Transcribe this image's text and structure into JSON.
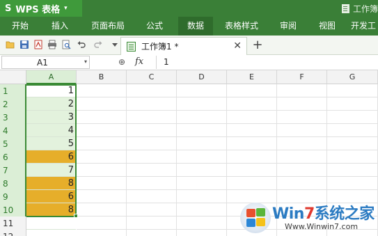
{
  "app": {
    "logo_glyph": "S",
    "name": "WPS 表格",
    "caret": "▾",
    "window_title": "工作簿"
  },
  "ribbon_tabs": [
    {
      "label": "开始"
    },
    {
      "label": "插入"
    },
    {
      "label": "页面布局"
    },
    {
      "label": "公式"
    },
    {
      "label": "数据",
      "active": true
    },
    {
      "label": "表格样式"
    },
    {
      "label": "审阅"
    },
    {
      "label": "视图"
    },
    {
      "label": "开发工"
    }
  ],
  "toolbar": {
    "icons": [
      "open-folder-icon",
      "save-icon",
      "export-pdf-icon",
      "print-icon",
      "print-preview-icon",
      "undo-icon",
      "redo-icon",
      "customize-dropdown-icon"
    ],
    "document_tab": "工作簿1 *",
    "close_glyph": "✕",
    "new_tab_glyph": "+"
  },
  "formula_bar": {
    "name_box": "A1",
    "name_box_caret": "▾",
    "zoom_glyph": "⊕",
    "fx_label": "fx",
    "value": "1"
  },
  "sheet": {
    "columns": [
      "A",
      "B",
      "C",
      "D",
      "E",
      "F",
      "G"
    ],
    "rows": [
      {
        "row": "1",
        "a": "1",
        "style": "active"
      },
      {
        "row": "2",
        "a": "2",
        "style": "sel"
      },
      {
        "row": "3",
        "a": "3",
        "style": "sel"
      },
      {
        "row": "4",
        "a": "4",
        "style": "sel"
      },
      {
        "row": "5",
        "a": "5",
        "style": "sel"
      },
      {
        "row": "6",
        "a": "6",
        "style": "orange"
      },
      {
        "row": "7",
        "a": "7",
        "style": "sel"
      },
      {
        "row": "8",
        "a": "8",
        "style": "orange"
      },
      {
        "row": "9",
        "a": "6",
        "style": "orange"
      },
      {
        "row": "10",
        "a": "8",
        "style": "orange"
      },
      {
        "row": "11",
        "a": "",
        "style": "none"
      },
      {
        "row": "12",
        "a": "",
        "style": "none"
      }
    ],
    "colors": {
      "highlight": "#e6ae2a",
      "selection": "#3a8a35"
    }
  },
  "watermark": {
    "brand_prefix": "Win",
    "brand_seven": "7",
    "brand_suffix": "系统之家",
    "url": "Www.Winwin7.com"
  }
}
